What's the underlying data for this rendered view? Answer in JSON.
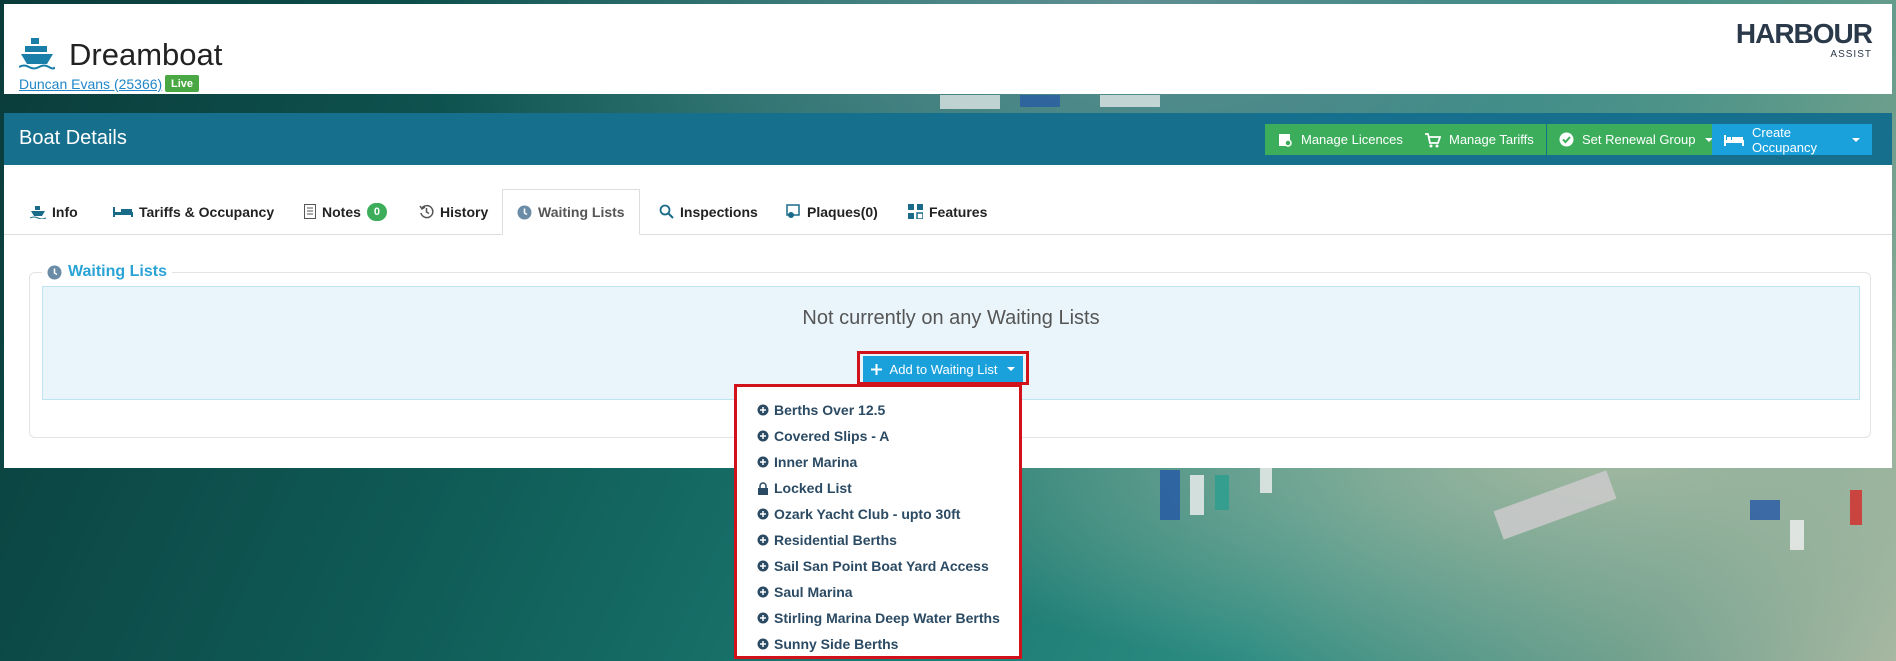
{
  "header": {
    "boat_name": "Dreamboat",
    "owner_link": "Duncan Evans (25366)",
    "status_badge": "Live",
    "logo_text": "HARBOUR",
    "logo_sub": "ASSIST",
    "boat_icon": "boat-icon"
  },
  "panel": {
    "title": "Boat Details",
    "buttons": {
      "manage_licences": "Manage Licences",
      "manage_tariffs": "Manage Tariffs",
      "set_renewal_group": "Set Renewal Group",
      "create_occupancy": "Create Occupancy"
    }
  },
  "tabs": {
    "info": "Info",
    "tariffs": "Tariffs & Occupancy",
    "notes": "Notes",
    "notes_count": "0",
    "history": "History",
    "waiting_lists": "Waiting Lists",
    "inspections": "Inspections",
    "plaques": "Plaques(0)",
    "features": "Features"
  },
  "waiting": {
    "legend": "Waiting Lists",
    "empty_message": "Not currently on any Waiting Lists",
    "add_button": "Add to Waiting List"
  },
  "dropdown": {
    "items": [
      "Berths Over 12.5",
      "Covered Slips - A",
      "Inner Marina",
      "Locked List",
      "Ozark Yacht Club - upto 30ft",
      "Residential Berths",
      "Sail San Point Boat Yard Access",
      "Saul Marina",
      "Stirling Marina Deep Water Berths",
      "Sunny Side Berths"
    ]
  },
  "colors": {
    "header_bar": "#176f8e",
    "green": "#3cae5b",
    "blue": "#1aa1dc",
    "highlight": "#d1121b"
  }
}
